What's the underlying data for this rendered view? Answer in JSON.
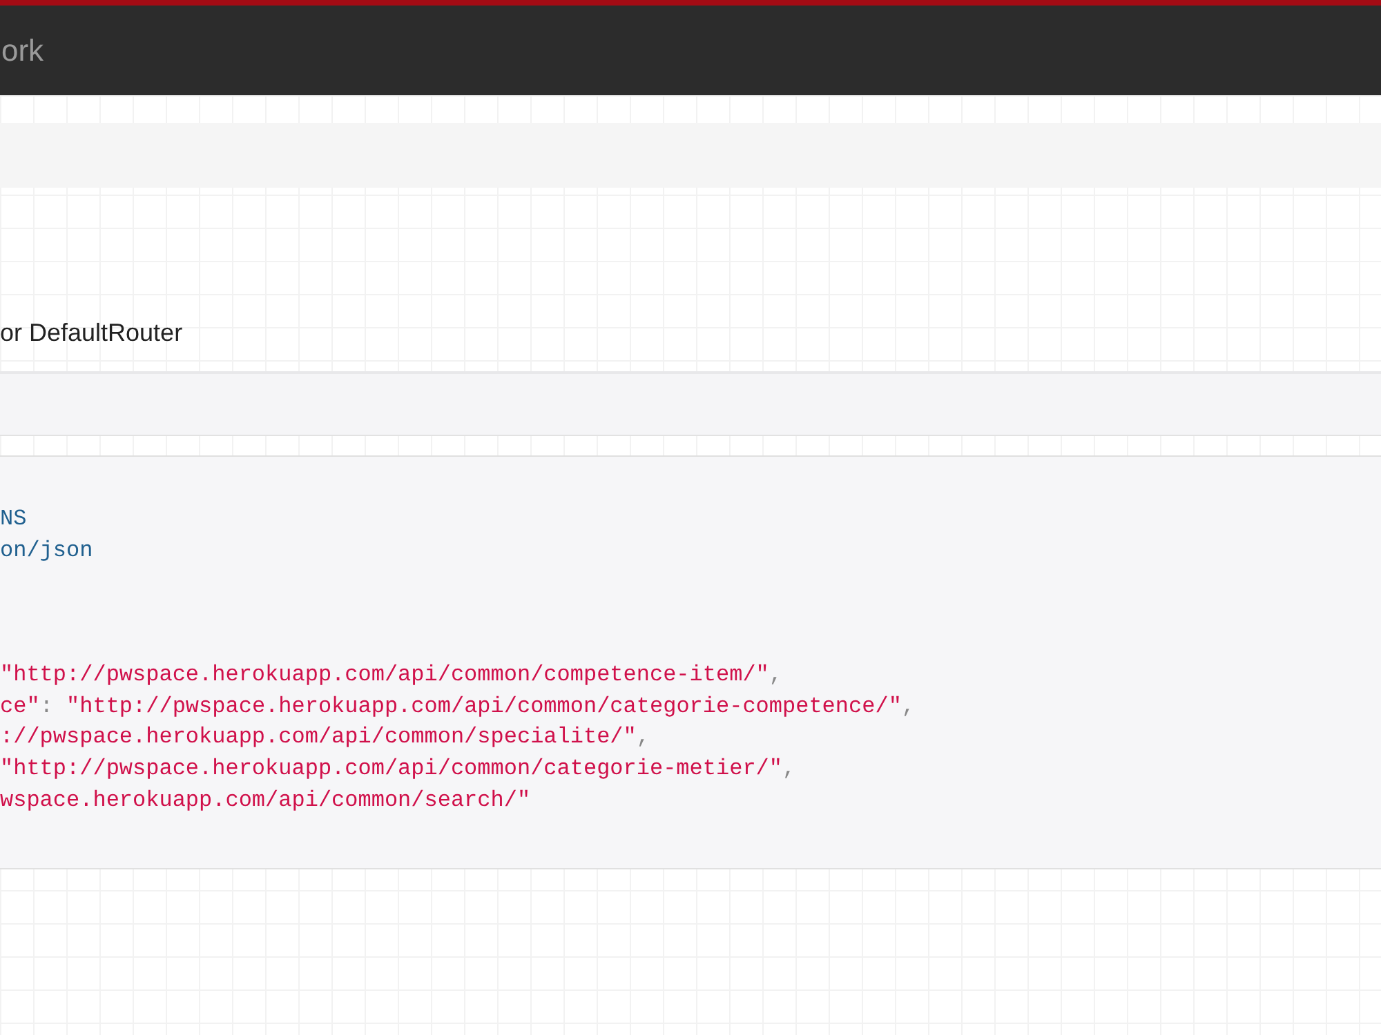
{
  "navbar": {
    "brand": "ork"
  },
  "page_title": "or DefaultRouter",
  "response": {
    "headers": [
      "NS",
      "on/json"
    ],
    "body": [
      [
        {
          "kind": "str",
          "text": "\"http://pwspace.herokuapp.com/api/common/competence-item/\""
        },
        {
          "kind": "punct",
          "text": ","
        }
      ],
      [
        {
          "kind": "str",
          "text": "ce\""
        },
        {
          "kind": "punct",
          "text": ":"
        },
        {
          "kind": "str",
          "text": "\"http://pwspace.herokuapp.com/api/common/categorie-competence/\""
        },
        {
          "kind": "punct",
          "text": ","
        }
      ],
      [
        {
          "kind": "str",
          "text": "://pwspace.herokuapp.com/api/common/specialite/\""
        },
        {
          "kind": "punct",
          "text": ","
        }
      ],
      [
        {
          "kind": "str",
          "text": "\"http://pwspace.herokuapp.com/api/common/categorie-metier/\""
        },
        {
          "kind": "punct",
          "text": ","
        }
      ],
      [
        {
          "kind": "str",
          "text": "wspace.herokuapp.com/api/common/search/\""
        }
      ]
    ]
  }
}
